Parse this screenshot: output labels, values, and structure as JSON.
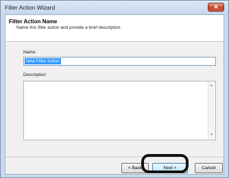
{
  "window": {
    "title": "Filter Action Wizard",
    "close_symbol": "✕"
  },
  "header": {
    "title": "Filter Action Name",
    "subtitle": "Name this filter action and provide a brief description."
  },
  "form": {
    "name_label": "Name:",
    "name_value": "New Filter Action",
    "description_label": "Description:",
    "description_value": ""
  },
  "buttons": {
    "back": "< Back",
    "next": "Next >",
    "cancel": "Cancel"
  },
  "icons": {
    "scroll_up": "▲",
    "scroll_down": "▼"
  },
  "colors": {
    "selection": "#3399ff",
    "highlight_ring": "#111111"
  }
}
